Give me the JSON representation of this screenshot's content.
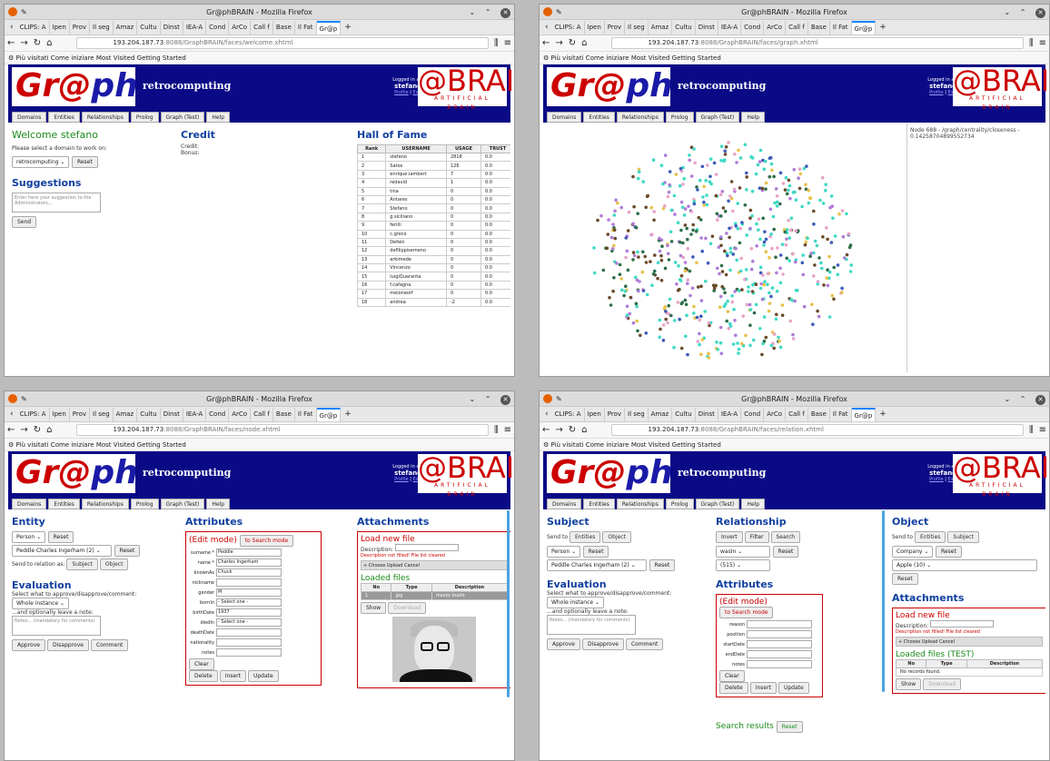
{
  "browser": {
    "title": "Gr@phBRAIN - Mozilla Firefox",
    "tabs": [
      "CLIPS: A",
      "Ipen",
      "Prov",
      "Il seg",
      "Amaz",
      "Cultu",
      "Dinst",
      "IEA-A",
      "Cond",
      "ArCo",
      "Call f",
      "Base",
      "Il Fat",
      "Gr@p"
    ],
    "bookmarks": "Più visitati   Come iniziare   Most Visited   Getting Started",
    "host": "193.204.187.73",
    "urls": [
      ":8088/GraphBRAIN/faces/welcome.xhtml",
      ":8088/GraphBRAIN/faces/graph.xhtml",
      ":8088/GraphBRAIN/faces/node.xhtml",
      ":8088/GraphBRAIN/faces/relation.xhtml"
    ]
  },
  "app": {
    "logo_a": "Gr@",
    "logo_b": "phBRAIN",
    "domain": "retrocomputing",
    "logged_prefix": "Logged in as",
    "user": "stefano",
    "profile": "Profile",
    "exit": "Exit",
    "brand": "@BRAIN",
    "brand_sub": "ARTIFICIAL BRAIN",
    "menu": [
      "Domains",
      "Entities",
      "Relationships",
      "Prolog",
      "Graph (Test)",
      "Help"
    ]
  },
  "welcome": {
    "title": "Welcome stefano",
    "prompt": "Please select a domain to work on:",
    "domain_value": "retrocomputing",
    "reset": "Reset",
    "suggestions": "Suggestions",
    "suggest_placeholder": "Enter here your suggestion to the Administrators...",
    "send": "Send",
    "credit_title": "Credit",
    "credit_lines": [
      "Credit:",
      "Bonus:"
    ],
    "hof_title": "Hall of Fame",
    "hof_headers": [
      "Rank",
      "USERNAME",
      "USAGE",
      "TRUST"
    ],
    "hof_rows": [
      [
        "1",
        "stefano",
        "2818",
        "0.0"
      ],
      [
        "2",
        "Satox",
        "126",
        "0.0"
      ],
      [
        "3",
        "enrique.lambert",
        "7",
        "0.0"
      ],
      [
        "4",
        "redavid",
        "1",
        "0.0"
      ],
      [
        "5",
        "tina",
        "0",
        "0.0"
      ],
      [
        "6",
        "Antares",
        "0",
        "0.0"
      ],
      [
        "7",
        "Stefano",
        "0",
        "0.0"
      ],
      [
        "8",
        "g.siciliano",
        "0",
        "0.0"
      ],
      [
        "9",
        "ferilli",
        "0",
        "0.0"
      ],
      [
        "10",
        "c.greco",
        "0",
        "0.0"
      ],
      [
        "11",
        "Defein",
        "0",
        "0.0"
      ],
      [
        "12",
        "defilippisemeno",
        "0",
        "0.0"
      ],
      [
        "13",
        "arkimede",
        "0",
        "0.0"
      ],
      [
        "14",
        "Vincenzo",
        "0",
        "0.0"
      ],
      [
        "15",
        "luigiQuaranta",
        "0",
        "0.0"
      ],
      [
        "16",
        "f.cafagna",
        "0",
        "0.0"
      ],
      [
        "17",
        "meloneorf",
        "0",
        "0.0"
      ],
      [
        "18",
        "andrea",
        "-2",
        "0.0"
      ]
    ]
  },
  "graph": {
    "node_info": "Node 688 - /graph/centrality/closeness - 0.14258704899552734"
  },
  "node": {
    "entity": "Entity",
    "entity_type": "Person",
    "reset": "Reset",
    "instance": "Peddle Charles Ingerham (2)",
    "send_to": "Send to relation as:",
    "subject": "Subject",
    "object": "Object",
    "evaluation": "Evaluation",
    "eval_prompt": "Select what to approve/disapprove/comment:",
    "eval_value": "Whole instance",
    "eval_note": "...and optionally leave a note:",
    "eval_placeholder": "Notes... (mandatory for comments)",
    "approve": "Approve",
    "disapprove": "Disapprove",
    "comment": "Comment",
    "attributes": "Attributes",
    "edit_mode": "(Edit mode)",
    "to_search": "to Search mode",
    "fields": [
      {
        "label": "surname *",
        "value": "Peddle"
      },
      {
        "label": "name *",
        "value": "Charles Ingerham"
      },
      {
        "label": "knownAs",
        "value": "Chuck"
      },
      {
        "label": "nickname",
        "value": ""
      },
      {
        "label": "gender",
        "value": "M"
      },
      {
        "label": "bornIn",
        "value": "- Select one -"
      },
      {
        "label": "birthDate",
        "value": "1937"
      },
      {
        "label": "diedIn",
        "value": "- Select one -"
      },
      {
        "label": "deathDate",
        "value": ""
      },
      {
        "label": "nationality",
        "value": ""
      },
      {
        "label": "notes",
        "value": ""
      }
    ],
    "clear": "Clear",
    "delete": "Delete",
    "insert": "Insert",
    "update": "Update",
    "attachments": "Attachments",
    "load_new": "Load new file",
    "description": "Description:",
    "desc_error": "Description not filled! File list cleared",
    "choose": "+ Choose",
    "upload": "Upload",
    "cancel": "Cancel",
    "loaded_files": "Loaded files",
    "file_headers": [
      "No",
      "Type",
      "Description"
    ],
    "file_row": [
      "1",
      "jpg",
      "mezzo busto"
    ],
    "show": "Show",
    "download": "Download"
  },
  "relation": {
    "subject": "Subject",
    "send_to": "Send to",
    "entities": "Entities",
    "object": "Object",
    "subj_type": "Person",
    "reset": "Reset",
    "subj_instance": "Peddle Charles Ingerham (2)",
    "evaluation": "Evaluation",
    "eval_prompt": "Select what to approve/disapprove/comment:",
    "eval_value": "Whole instance",
    "eval_note": "...and optionally leave a note:",
    "eval_placeholder": "Notes... (mandatory for comments)",
    "approve": "Approve",
    "disapprove": "Disapprove",
    "comment": "Comment",
    "relationship": "Relationship",
    "invert": "Invert",
    "filter": "Filter",
    "search": "Search",
    "rel_type": "wasIn",
    "rel_count": "(515)",
    "attributes": "Attributes",
    "edit_mode": "(Edit mode)",
    "to_search": "to Search mode",
    "fields": [
      "reason",
      "position",
      "startDate",
      "endDate",
      "notes"
    ],
    "clear": "Clear",
    "delete": "Delete",
    "insert": "Insert",
    "update": "Update",
    "search_results": "Search results",
    "obj_title": "Object",
    "obj_type": "Company",
    "obj_instance": "Apple (10)",
    "attachments": "Attachments",
    "load_new": "Load new file",
    "description": "Description:",
    "desc_error": "Description not filled! File list cleared",
    "choose": "+ Choose",
    "upload": "Upload",
    "cancel": "Cancel",
    "loaded_files": "Loaded files (TEST)",
    "file_headers": [
      "No",
      "Type",
      "Description"
    ],
    "no_records": "No records found.",
    "show": "Show",
    "download": "Download"
  }
}
